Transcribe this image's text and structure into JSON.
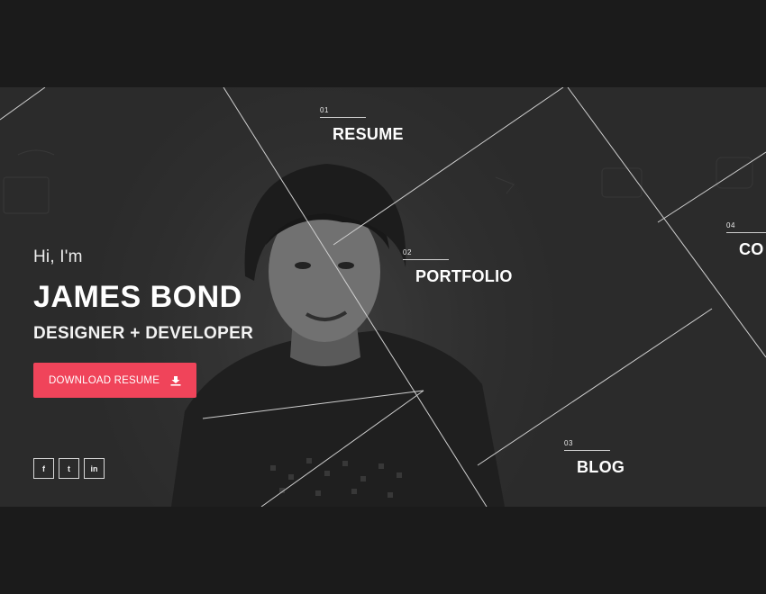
{
  "hero": {
    "greeting": "Hi, I'm",
    "name": "JAMES BOND",
    "role": "DESIGNER + DEVELOPER",
    "download_label": "DOWNLOAD RESUME",
    "accent_color": "#f0445a"
  },
  "social": [
    {
      "label": "f",
      "icon": "facebook-icon"
    },
    {
      "label": "t",
      "icon": "twitter-icon"
    },
    {
      "label": "in",
      "icon": "linkedin-icon"
    }
  ],
  "nav": [
    {
      "num": "01",
      "label": "RESUME"
    },
    {
      "num": "02",
      "label": "PORTFOLIO"
    },
    {
      "num": "03",
      "label": "BLOG"
    },
    {
      "num": "04",
      "label": "CO"
    }
  ]
}
